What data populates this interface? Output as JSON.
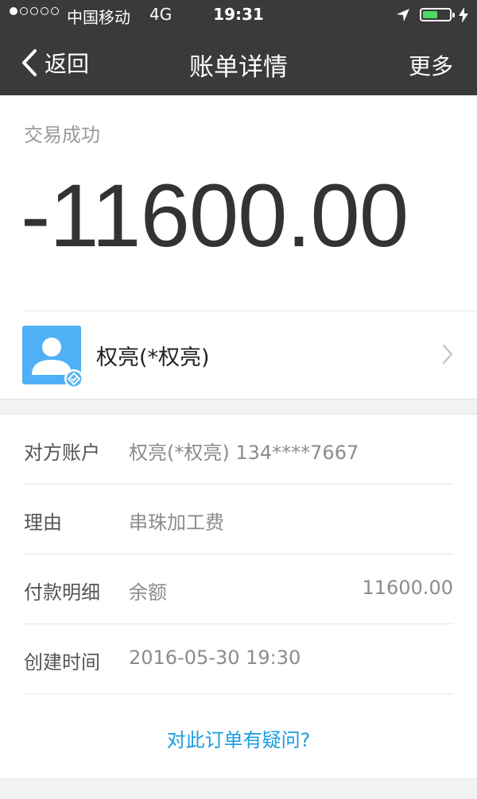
{
  "status_bar": {
    "carrier": "中国移动",
    "network": "4G",
    "time": "19:31",
    "signal_bars": 1,
    "signal_total": 5,
    "battery_color": "#4cd964",
    "icons": [
      "location-arrow-icon",
      "battery-icon",
      "charging-bolt-icon"
    ]
  },
  "nav": {
    "back_label": "返回",
    "title": "账单详情",
    "more_label": "更多"
  },
  "transaction": {
    "status": "交易成功",
    "amount": "-11600.00"
  },
  "payee": {
    "name": "权亮(*权亮)",
    "avatar_color": "#4fb0f5"
  },
  "details": {
    "rows": [
      {
        "label": "对方账户",
        "value": "权亮(*权亮) 134****7667",
        "right_value": ""
      },
      {
        "label": "理由",
        "value": "串珠加工费",
        "right_value": ""
      },
      {
        "label": "付款明细",
        "value": "余额",
        "right_value": "11600.00"
      },
      {
        "label": "创建时间",
        "value": "2016-05-30 19:30",
        "right_value": ""
      }
    ],
    "help_link": "对此订单有疑问?",
    "link_color": "#1a9de0"
  }
}
